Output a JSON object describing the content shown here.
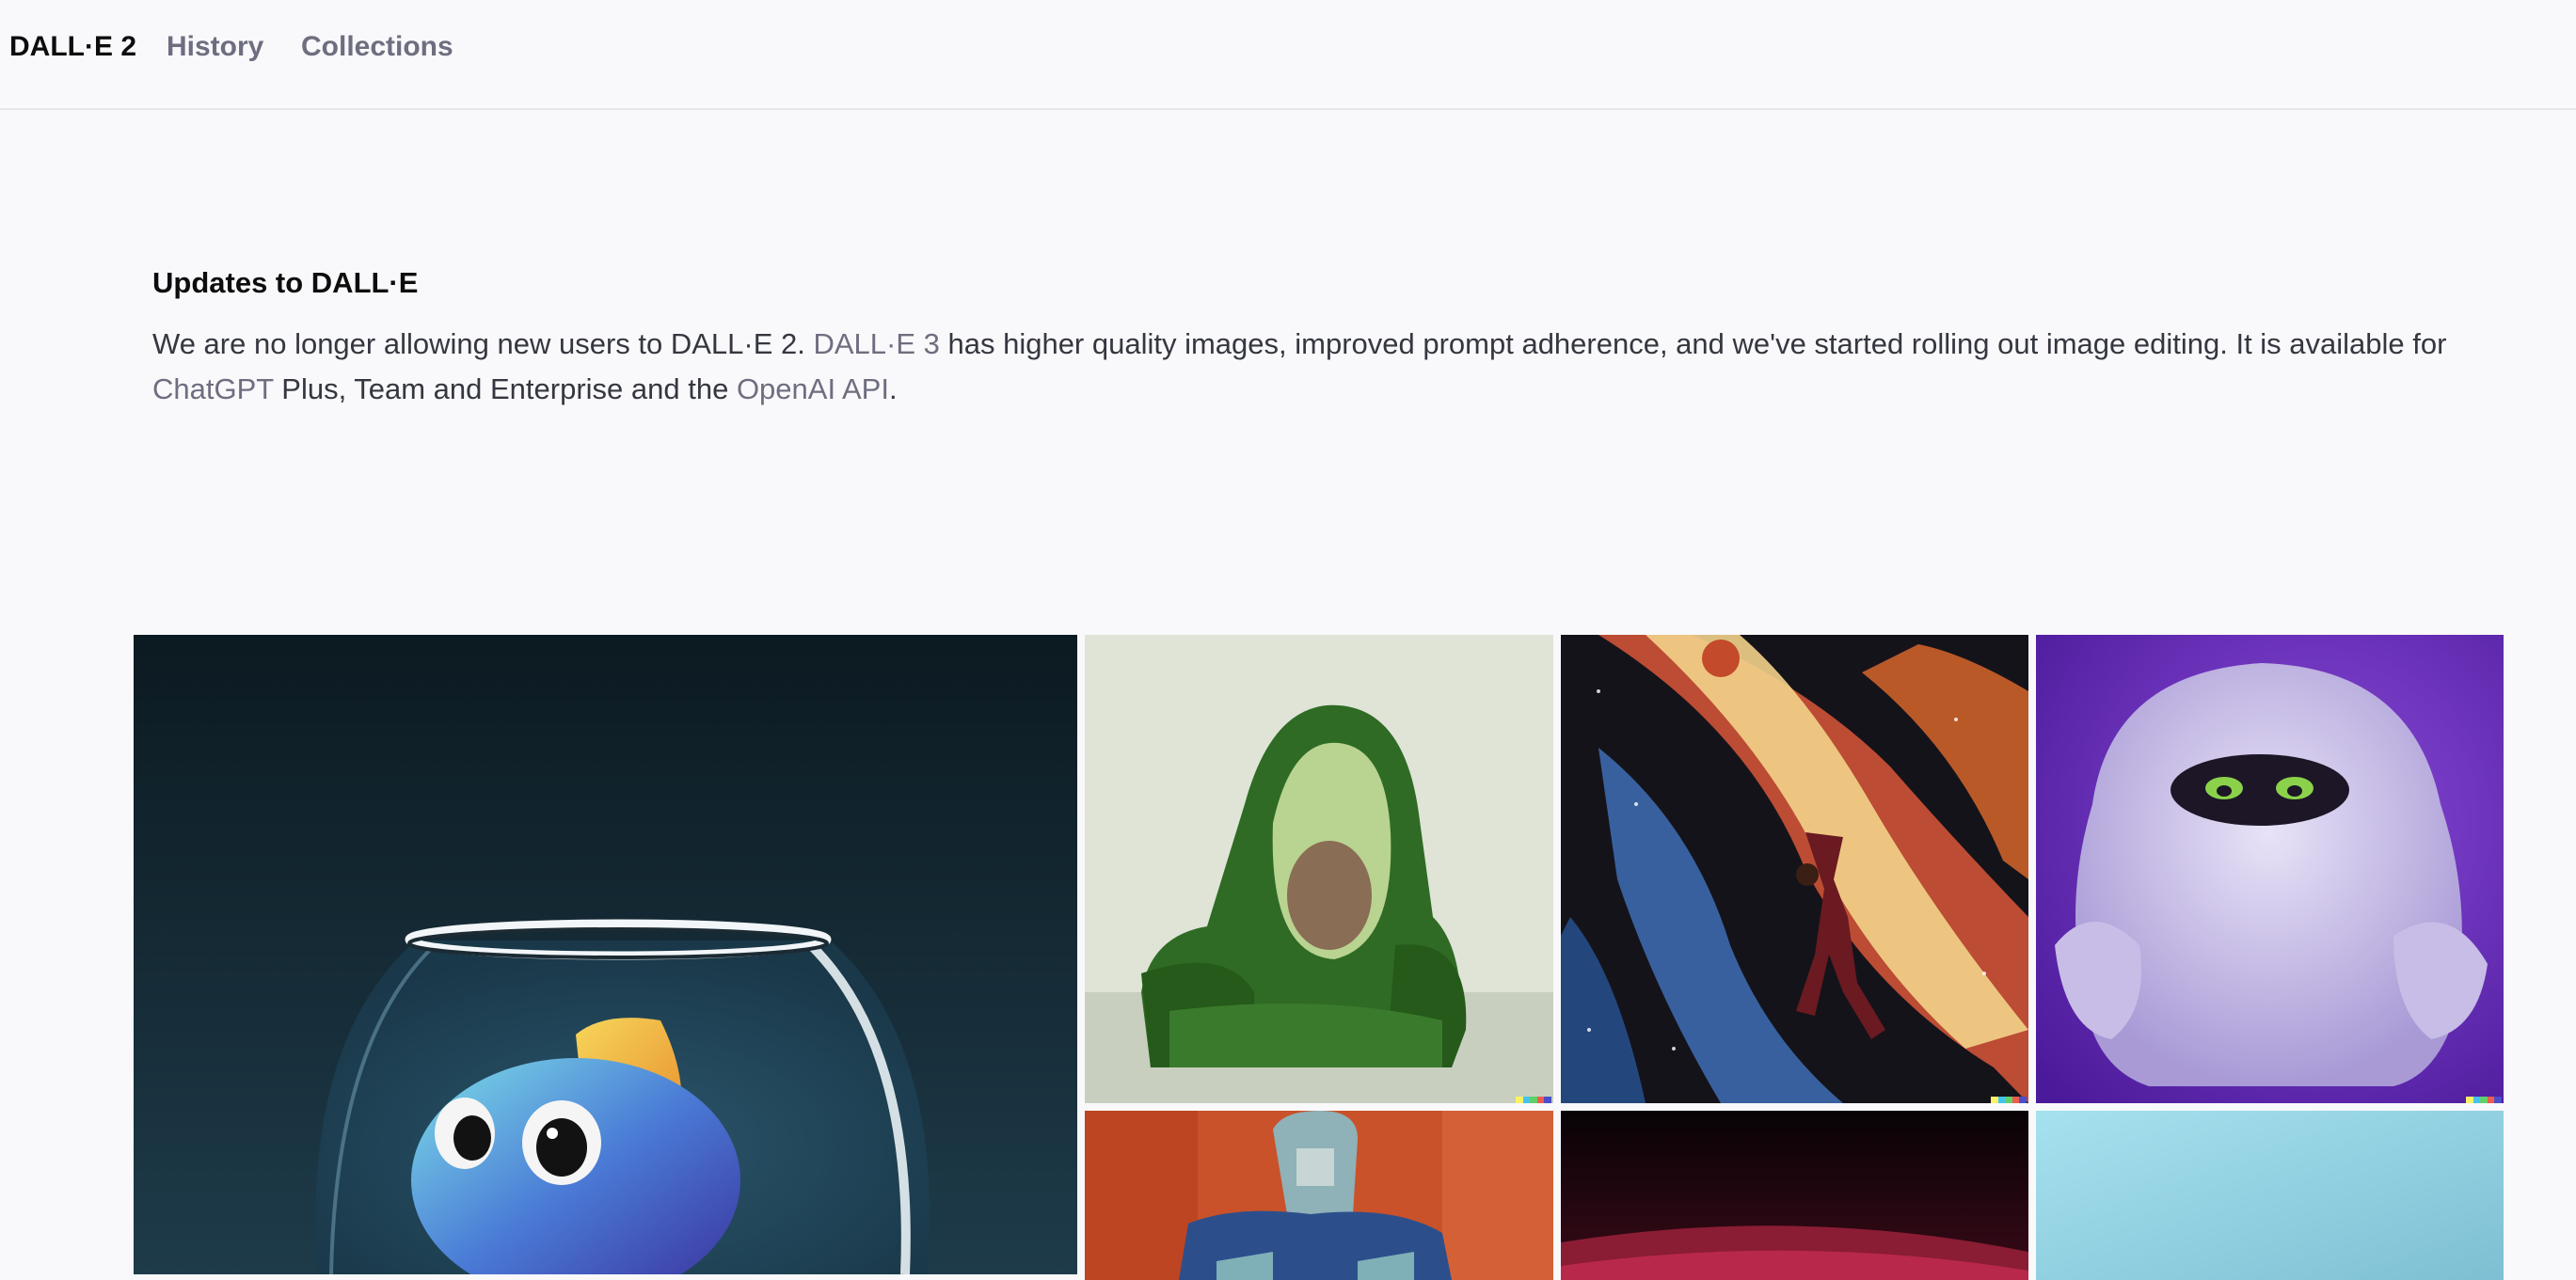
{
  "nav": {
    "brand": "DALL·E 2",
    "history": "History",
    "collections": "Collections"
  },
  "notice": {
    "title": "Updates to DALL·E",
    "text_1": "We are no longer allowing new users to DALL·E 2. ",
    "link_dalle3": "DALL·E 3",
    "text_2": " has higher quality images, improved prompt adherence, and we've started rolling out image editing. It is available for ",
    "link_chatgpt": "ChatGPT",
    "text_3": " Plus, Team and Enterprise and the ",
    "link_api": "OpenAI API",
    "text_4": "."
  },
  "gallery": {
    "tiles": [
      {
        "subject": "fish in a fishbowl",
        "icon": "fishbowl-image"
      },
      {
        "subject": "avocado armchair",
        "icon": "avocado-chair-image"
      },
      {
        "subject": "basketball player dunking in space painting",
        "icon": "space-dunk-image"
      },
      {
        "subject": "purple furry monster",
        "icon": "monster-image"
      },
      {
        "subject": "abstract portrait painting",
        "icon": "portrait-painting-image"
      },
      {
        "subject": "dark red abstract",
        "icon": "dark-red-image"
      },
      {
        "subject": "light blue abstract",
        "icon": "light-blue-image"
      }
    ],
    "signature_colors": [
      "#fdf166",
      "#43c3f0",
      "#5fd16a",
      "#f05b4b",
      "#4a4ecb"
    ]
  }
}
